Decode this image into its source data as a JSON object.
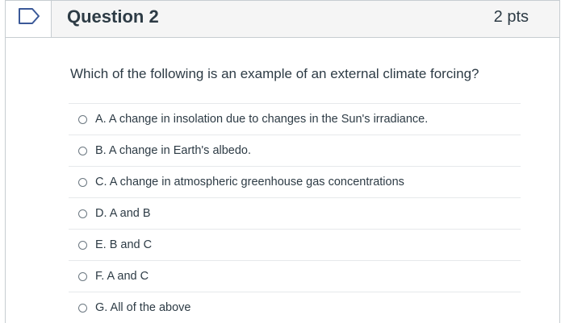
{
  "question": {
    "title": "Question 2",
    "points": "2 pts",
    "text": "Which of the following is an example of an external climate forcing?",
    "flag_icon": "bookmark-flag-icon"
  },
  "answers": [
    {
      "label": "A. A change in insolation due to changes in the Sun's irradiance."
    },
    {
      "label": "B. A change in Earth's albedo."
    },
    {
      "label": "C. A change in atmospheric greenhouse gas concentrations"
    },
    {
      "label": "D. A and B"
    },
    {
      "label": "E. B and C"
    },
    {
      "label": "F. A and C"
    },
    {
      "label": "G. All of the above"
    }
  ],
  "colors": {
    "text": "#2d3b45",
    "header_bg": "#f5f5f5",
    "border": "#c7cdd1"
  }
}
